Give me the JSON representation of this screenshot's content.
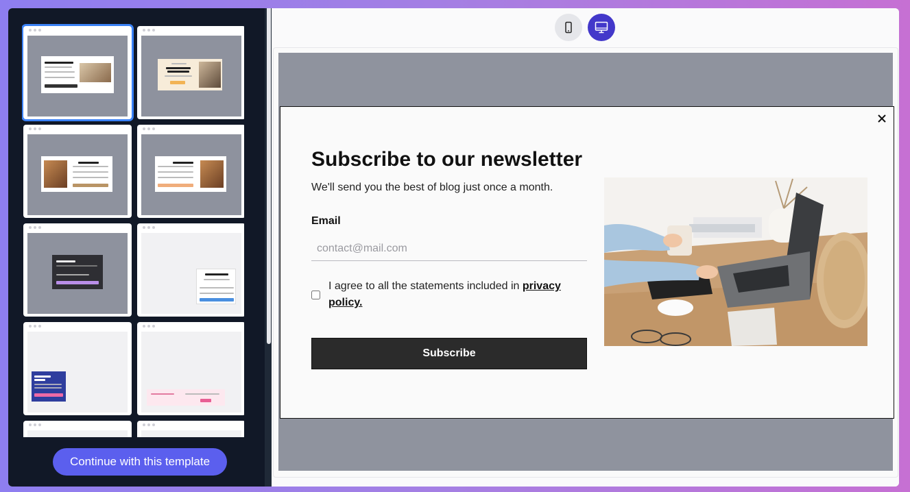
{
  "sidebar": {
    "templates": [
      {
        "title": "Subscribe to our newsletter"
      },
      {
        "title": "Ready to score some exclusive deals?"
      },
      {
        "title": "Join Our Mailing List"
      },
      {
        "title": ""
      },
      {
        "title": "Welcome Offer"
      },
      {
        "title": "Stay Updated with Our Newsletter"
      },
      {
        "title": "Get Your 15% Promo!"
      },
      {
        "title": "Get 15% Off Everything Today"
      }
    ],
    "continue_label": "Continue with this template"
  },
  "preview": {
    "mode_mobile_icon": "mobile-phone-icon",
    "mode_desktop_icon": "desktop-monitor-icon",
    "active_mode": "desktop",
    "popup": {
      "title": "Subscribe to our newsletter",
      "subtitle": "We'll send you the best of blog just once a month.",
      "email_label": "Email",
      "email_placeholder": "contact@mail.com",
      "consent_text": "I agree to all the statements included in ",
      "consent_link": "privacy policy.",
      "subscribe_label": "Subscribe",
      "close_icon": "close-icon"
    }
  },
  "colors": {
    "sidebar_bg": "#111827",
    "accent": "#5b5fee",
    "desktop_toggle": "#4338ca",
    "selected_outline": "#3b82f6",
    "backdrop": "#8f939e",
    "button_dark": "#2b2b2b"
  }
}
